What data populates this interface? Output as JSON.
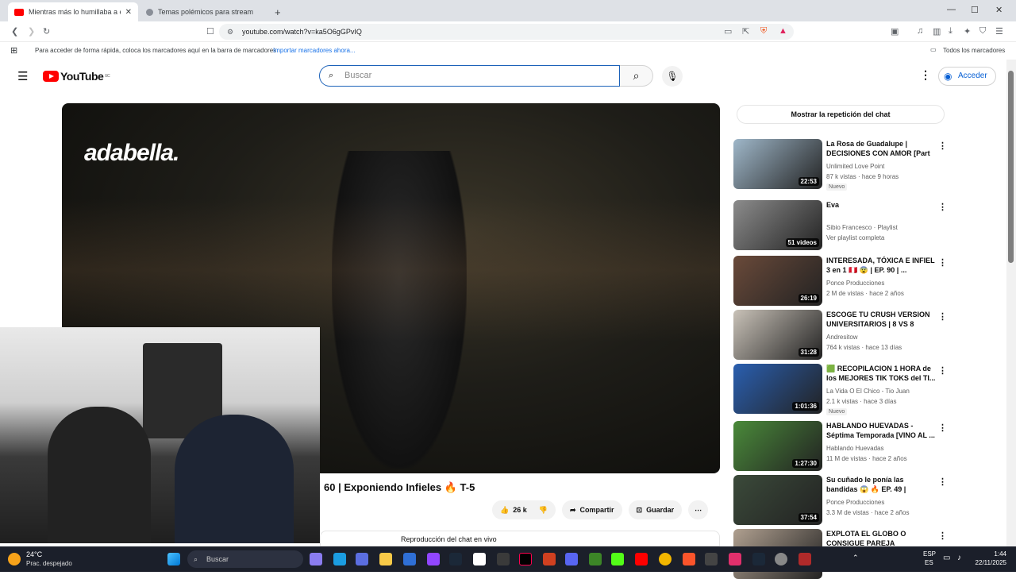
{
  "browser": {
    "tabs": [
      {
        "title": "Mientras más lo humillaba a él n",
        "active": true
      },
      {
        "title": "Temas polémicos para stream",
        "active": false
      }
    ],
    "new_tab": "+",
    "url": "youtube.com/watch?v=ka5O6gGPvIQ",
    "bookmarks_text": "Para acceder de forma rápida, coloca los marcadores aquí en la barra de marcadores",
    "bookmarks_link": "Importar marcadores ahora...",
    "all_bookmarks": "Todos los marcadores",
    "window_controls": [
      "—",
      "☐",
      "✕"
    ]
  },
  "youtube": {
    "logo_text": "YouTube",
    "logo_country": "EC",
    "search_placeholder": "Buscar",
    "signin": "Acceder",
    "video_title": "60 | Exponiendo Infieles 🔥 T-5",
    "overlay_watermark": "adabella.",
    "likes": "26 k",
    "share": "Compartir",
    "save": "Guardar",
    "chat_live": "Reproducción del chat en vivo",
    "chat_replay": "Mostrar la repetición del chat",
    "recommendations": [
      {
        "title": "La Rosa de Guadalupe | DECISIONES CON AMOR [Part ...",
        "channel": "Unlimited Love Point",
        "meta": "87 k vistas · hace 9 horas",
        "duration": "22:53",
        "badge": "Nuevo",
        "color": "#9fb7c9"
      },
      {
        "title": "Eva",
        "channel": "Sibio Francesco · Playlist",
        "meta": "Ver playlist completa",
        "duration": "51 videos",
        "badge": "",
        "color": "#8c8c8c"
      },
      {
        "title": "INTERESADA, TÓXICA E INFIEL 3 en 1 🇵🇪 😨 | EP. 90 | ...",
        "channel": "Ponce Producciones",
        "meta": "2 M de vistas · hace 2 años",
        "duration": "26:19",
        "badge": "",
        "color": "#6a4a3a"
      },
      {
        "title": "ESCOGE TU CRUSH VERSION UNIVERSITARIOS | 8 VS 8",
        "channel": "Andresitow",
        "meta": "764 k vistas · hace 13 días",
        "duration": "31:28",
        "badge": "",
        "color": "#c9c2b8"
      },
      {
        "title": "🟩 RECOPILACION 1 HORA de los MEJORES TIK TOKS del TI...",
        "channel": "La Vida O El Chico - Tio Juan",
        "meta": "2.1 k vistas · hace 3 días",
        "duration": "1:01:36",
        "badge": "Nuevo",
        "color": "#2a5fb0"
      },
      {
        "title": "HABLANDO HUEVADAS - Séptima Temporada [VINO AL ...",
        "channel": "Hablando Huevadas",
        "meta": "11 M de vistas · hace 2 años",
        "duration": "1:27:30",
        "badge": "",
        "color": "#4a8a3a"
      },
      {
        "title": "Su cuñado le ponía las bandidas 😱 🔥 EP. 49 | Exponiendo ...",
        "channel": "Ponce Producciones",
        "meta": "3.3 M de vistas · hace 2 años",
        "duration": "37:54",
        "badge": "",
        "color": "#3b4a3a"
      },
      {
        "title": "EXPLOTA EL GLOBO O CONSIGUE PAREJA",
        "channel": "",
        "meta": "",
        "duration": "",
        "badge": "",
        "color": "#b0a090"
      }
    ]
  },
  "taskbar": {
    "weather_temp": "24°C",
    "weather_desc": "Prac. despejado",
    "search": "Buscar",
    "lang": "ESP",
    "lang2": "ES",
    "time": "1:44",
    "date": "22/11/2025"
  }
}
